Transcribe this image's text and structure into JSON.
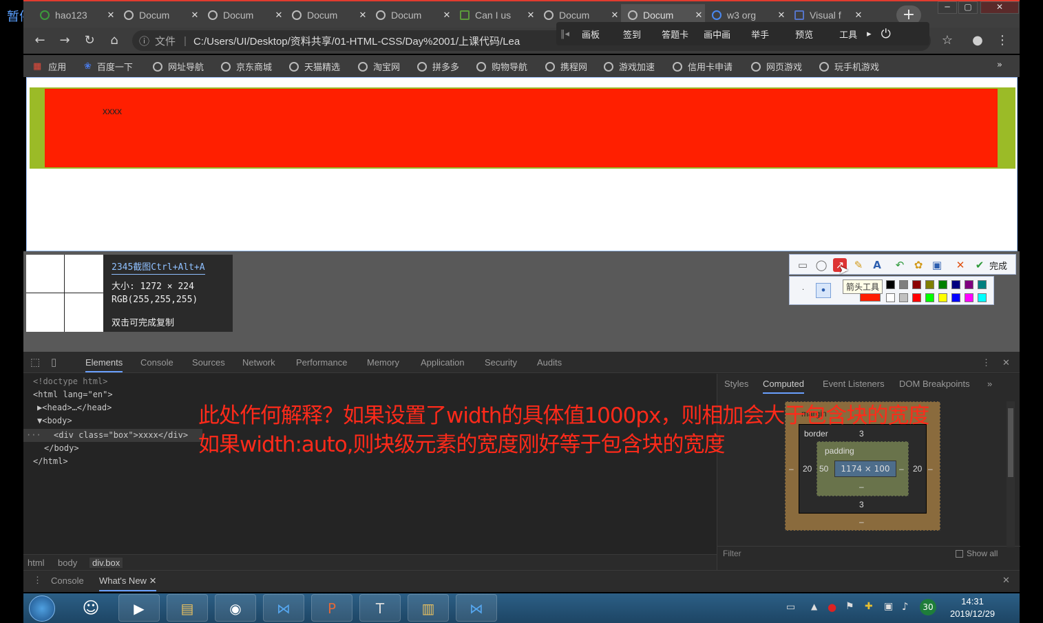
{
  "overlay": {
    "pause_label": "暂停"
  },
  "tabs": [
    {
      "title": "hao123",
      "icon": "check-icon"
    },
    {
      "title": "Docum",
      "icon": "globe-icon"
    },
    {
      "title": "Docum",
      "icon": "globe-icon"
    },
    {
      "title": "Docum",
      "icon": "globe-icon"
    },
    {
      "title": "Docum",
      "icon": "globe-icon"
    },
    {
      "title": "Can I us",
      "icon": "caniuse-icon"
    },
    {
      "title": "Docum",
      "icon": "globe-icon"
    },
    {
      "title": "Docum",
      "icon": "globe-icon",
      "active": true
    },
    {
      "title": "w3 org",
      "icon": "google-icon"
    },
    {
      "title": "Visual f",
      "icon": "w3c-icon"
    }
  ],
  "toolbar": {
    "url_prefix": "文件",
    "url": "C:/Users/UI/Desktop/资料共享/01-HTML-CSS/Day%2001/上课代码/Lea"
  },
  "pen_toolbar": [
    "画板",
    "签到",
    "答题卡",
    "画中画",
    "举手",
    "预览",
    "工具"
  ],
  "bookmarks": [
    "应用",
    "百度一下",
    "网址导航",
    "京东商城",
    "天猫精选",
    "淘宝网",
    "拼多多",
    "购物导航",
    "携程网",
    "游戏加速",
    "信用卡申请",
    "网页游戏",
    "玩手机游戏"
  ],
  "page": {
    "box_text": "xxxx"
  },
  "screenshot_info": {
    "title": "2345截图Ctrl+Alt+A",
    "size": "大小: 1272 × 224",
    "rgb": "RGB(255,255,255)",
    "hint": "双击可完成复制"
  },
  "screenshot_tool": {
    "done_label": "完成",
    "tooltip": "箭头工具"
  },
  "devtools": {
    "tabs": [
      "Elements",
      "Console",
      "Sources",
      "Network",
      "Performance",
      "Memory",
      "Application",
      "Security",
      "Audits"
    ],
    "code": [
      "<!doctype html>",
      "<html lang=\"en\">",
      "▶<head>…</head>",
      "▼<body>",
      "<div class=\"box\">xxxx</div>",
      "</body>",
      "</html>"
    ],
    "side_tabs": [
      "Styles",
      "Computed",
      "Event Listeners",
      "DOM Breakpoints"
    ],
    "box_model": {
      "margin_label": "margin",
      "border_label": "border",
      "border_value": "3",
      "padding_label": "padding",
      "padding_left": "50",
      "margin_left": "20",
      "margin_right": "20",
      "content": "1174 × 100",
      "dash": "–"
    },
    "filter_placeholder": "Filter",
    "show_all": "Show all",
    "breadcrumb": [
      "html",
      "body",
      "div.box"
    ],
    "drawer_tabs": [
      "Console",
      "What's New"
    ]
  },
  "annotation": {
    "line1": "此处作何解释？如果设置了width的具体值1000px，则相加会大于包含块的宽度",
    "line2": "如果width:auto,则块级元素的宽度刚好等于包含块的宽度"
  },
  "taskbar": {
    "time": "14:31",
    "date": "2019/12/29",
    "badge": "30"
  },
  "colors": {
    "box_bg": "#ff1f00",
    "margin_highlight": "#9bbb27",
    "annotation": "#ff2a1a",
    "accent": "#6aa0ff"
  }
}
